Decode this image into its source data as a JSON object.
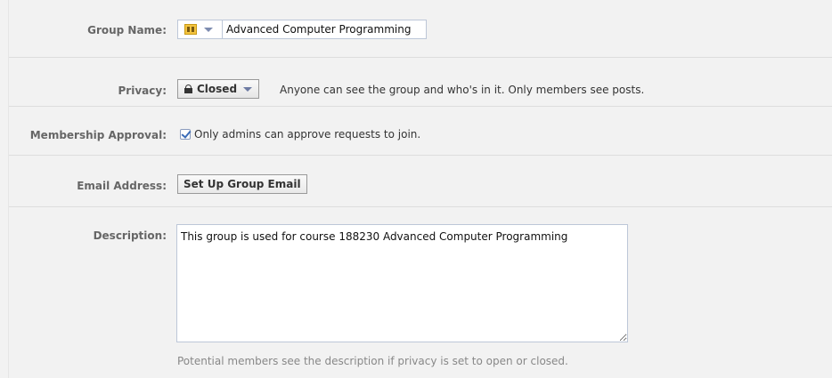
{
  "group_name": {
    "label": "Group Name:",
    "icon": "group-icon",
    "value": "Advanced Computer Programming"
  },
  "privacy": {
    "label": "Privacy:",
    "selected": "Closed",
    "icon": "lock-icon",
    "note": "Anyone can see the group and who's in it. Only members see posts."
  },
  "membership": {
    "label": "Membership Approval:",
    "checked": true,
    "text": "Only admins can approve requests to join."
  },
  "email": {
    "label": "Email Address:",
    "button": "Set Up Group Email"
  },
  "description": {
    "label": "Description:",
    "value": "This group is used for course 188230 Advanced Computer Programming",
    "hint": "Potential members see the description if privacy is set to open or closed."
  }
}
